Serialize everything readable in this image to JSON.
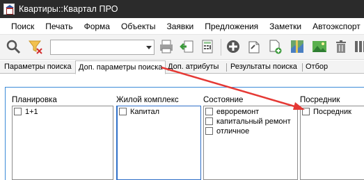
{
  "window": {
    "title": "Квартиры::Квартал ПРО"
  },
  "menu": {
    "items": [
      "Поиск",
      "Печать",
      "Форма",
      "Объекты",
      "Заявки",
      "Предложения",
      "Заметки",
      "Автоэкспорт"
    ]
  },
  "toolbar": {
    "combo_value": "",
    "icons": [
      "search-icon",
      "filter-clear-icon",
      "print-icon",
      "import-icon",
      "calculator-icon",
      "add-icon",
      "edit-icon",
      "new-document-icon",
      "map-icon",
      "image-icon",
      "delete-icon",
      "columns-icon"
    ]
  },
  "tabs": [
    {
      "label": "Параметры поиска",
      "active": false
    },
    {
      "label": "Доп. параметры поиска",
      "active": true
    },
    {
      "label": "Доп. атрибуты",
      "active": false
    },
    {
      "label": "Результаты поиска",
      "active": false
    },
    {
      "label": "Отбор",
      "active": false
    }
  ],
  "columns": [
    {
      "header": "Планировка",
      "options": [
        "1+1"
      ]
    },
    {
      "header": "Жилой комплекс",
      "options": [
        "Капитал"
      ]
    },
    {
      "header": "Состояние",
      "options": [
        "евроремонт",
        "капитальный ремонт",
        "отличное"
      ]
    },
    {
      "header": "Посредник",
      "options": [
        "Посредник"
      ]
    }
  ],
  "colors": {
    "titlebar": "#2b2b2b",
    "accent_arrow": "#e53935",
    "selection_border": "#2f6fc8"
  }
}
